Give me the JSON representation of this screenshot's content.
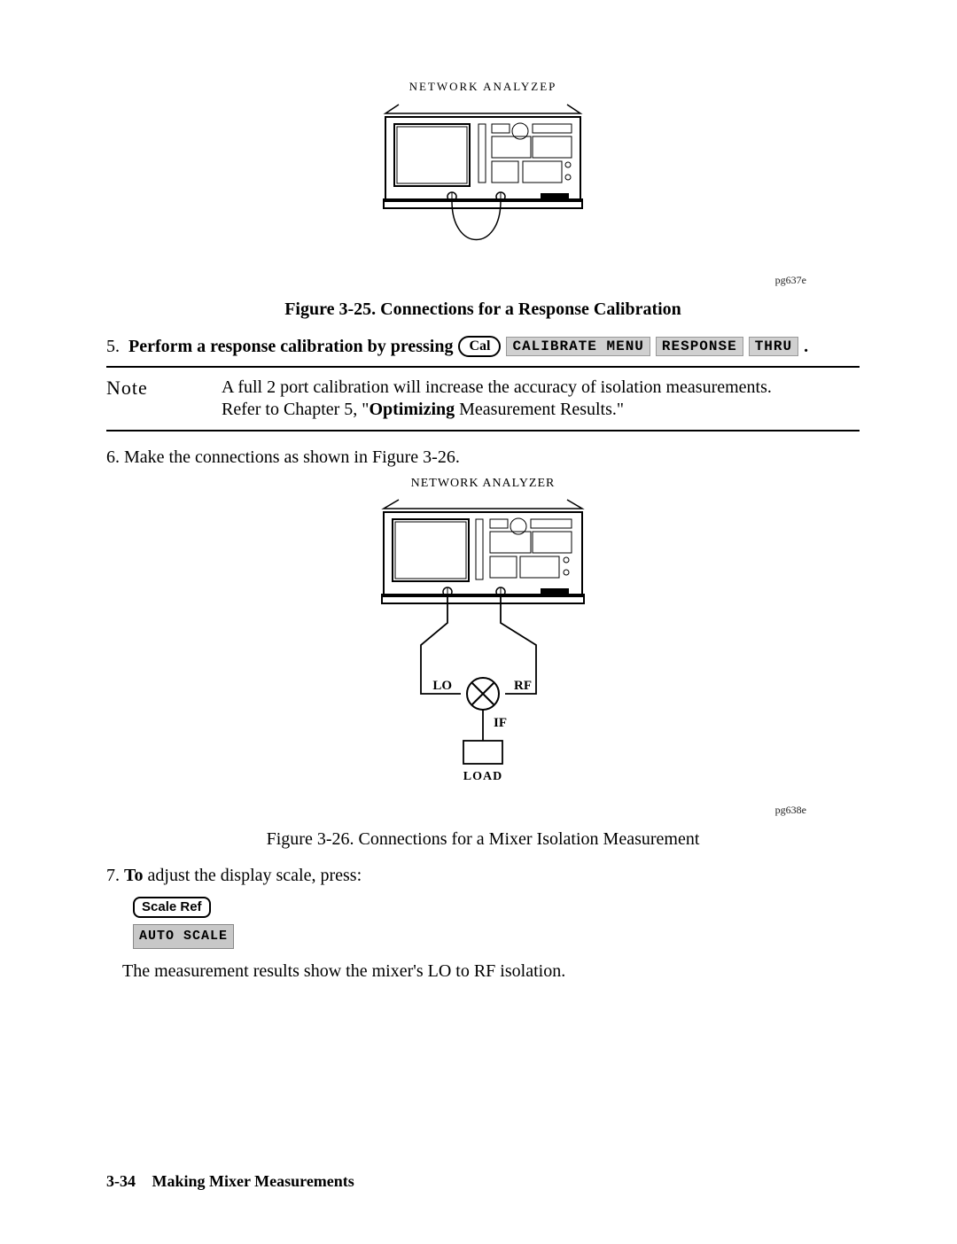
{
  "figure1": {
    "label_top": "NETWORK ANALYZEP",
    "ref": "pg637e",
    "caption": "Figure 3-25. Connections for a Response Calibration"
  },
  "step5": {
    "num": "5.",
    "text_a": "Perform a response calibration by pressing",
    "key_cal": "Cal",
    "soft1": "CALIBRATE MENU",
    "soft2": "RESPONSE",
    "soft3": "THRU",
    "period": "."
  },
  "note": {
    "label": "Note",
    "line1": "A full 2 port calibration will increase the accuracy of isolation measurements.",
    "line2_a": "Refer to Chapter 5, \"",
    "line2_b": "Optimizing",
    "line2_c": " Measurement Results.\""
  },
  "step6": {
    "text": "6. Make the connections as shown in Figure 3-26."
  },
  "figure2": {
    "label_top": "NETWORK ANALYZER",
    "lo": "LO",
    "rf": "RF",
    "if": "IF",
    "load": "LOAD",
    "ref": "pg638e",
    "caption": "Figure 3-26. Connections for a Mixer Isolation Measurement"
  },
  "step7": {
    "num": "7.",
    "to": "To",
    "rest": " adjust the display scale, press:",
    "key_scale": "Scale Ref",
    "soft_auto": "AUTO SCALE",
    "result": "The measurement results show the mixer's LO to RF isolation."
  },
  "footer": {
    "page": "3-34",
    "title": "Making Mixer Measurements"
  }
}
